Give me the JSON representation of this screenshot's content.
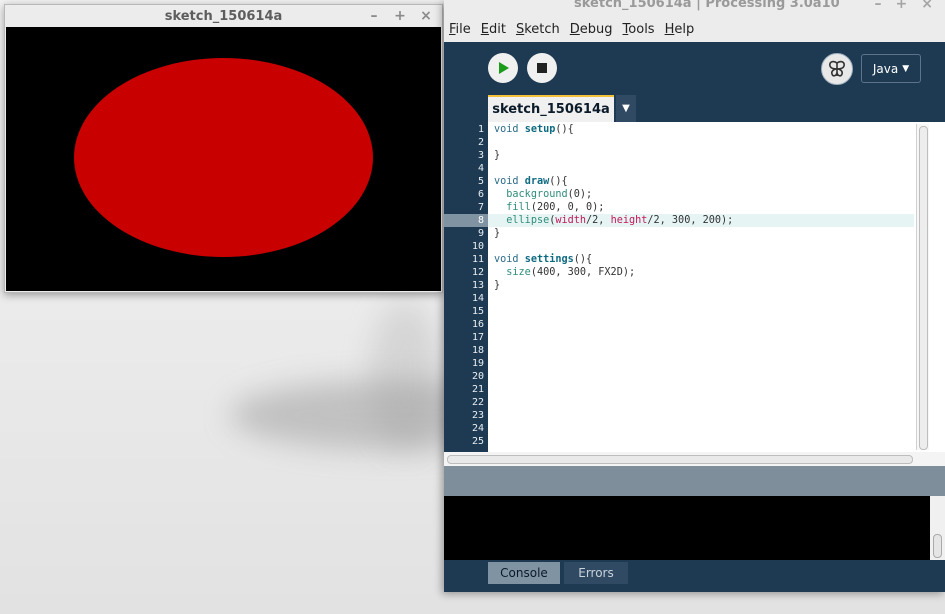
{
  "sketch_window": {
    "title": "sketch_150614a",
    "controls": {
      "minimize": "–",
      "maximize": "+",
      "close": "×"
    },
    "canvas": {
      "background": "#000000",
      "ellipse_fill": "#c80000"
    }
  },
  "ide_window": {
    "title": "sketch_150614a | Processing 3.0a10",
    "controls": {
      "minimize": "–",
      "maximize": "+",
      "close": "×"
    },
    "menu": [
      {
        "label": "File",
        "mnemonic": "F"
      },
      {
        "label": "Edit",
        "mnemonic": "E"
      },
      {
        "label": "Sketch",
        "mnemonic": "S"
      },
      {
        "label": "Debug",
        "mnemonic": "D"
      },
      {
        "label": "Tools",
        "mnemonic": "T"
      },
      {
        "label": "Help",
        "mnemonic": "H"
      }
    ],
    "toolbar": {
      "run_icon": "play-icon",
      "stop_icon": "stop-icon",
      "mode_icon": "butterfly-icon",
      "mode_label": "Java",
      "mode_arrow": "▼"
    },
    "tab": {
      "label": "sketch_150614a",
      "menu_arrow": "▼"
    },
    "editor": {
      "current_line": 8,
      "line_count": 25
    },
    "bottom_tabs": {
      "console": "Console",
      "errors": "Errors"
    },
    "colors": {
      "accent_tab": "#f4c03a",
      "chrome": "#1e3a52"
    }
  }
}
